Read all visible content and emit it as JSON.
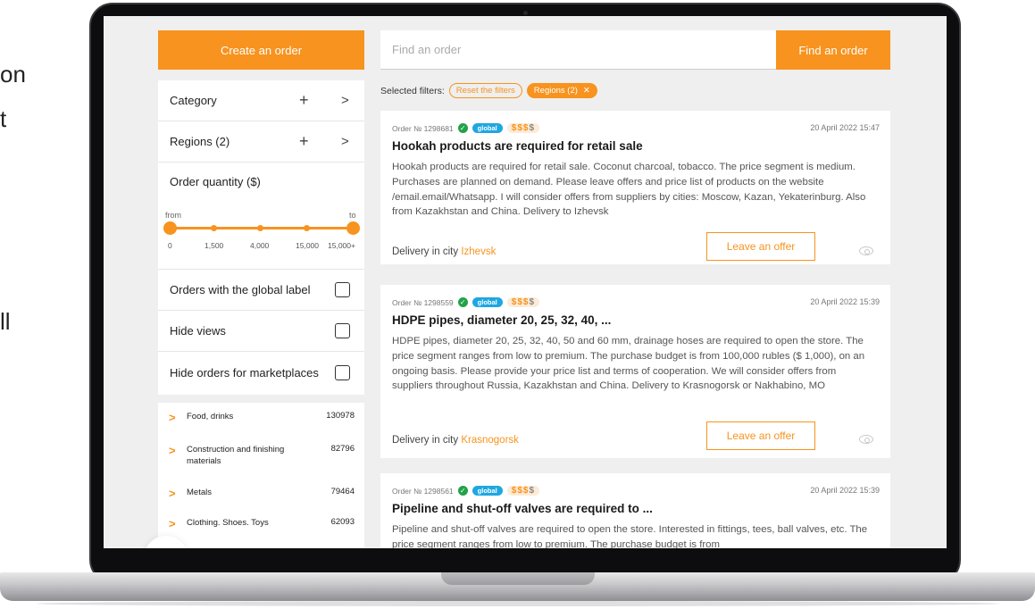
{
  "background_fragments": [
    "on",
    "t",
    "ll"
  ],
  "sidebar": {
    "create_label": "Create an order",
    "rows": [
      {
        "label": "Category"
      },
      {
        "label": "Regions (2)"
      }
    ],
    "slider": {
      "title": "Order quantity ($)",
      "from_label": "from",
      "to_label": "to",
      "ticks": [
        "0",
        "1,500",
        "4,000",
        "15,000",
        "15,000+"
      ]
    },
    "checkboxes": [
      {
        "label": "Orders with the global label",
        "checked": false
      },
      {
        "label": "Hide views",
        "checked": false
      },
      {
        "label": "Hide orders for marketplaces",
        "checked": false
      }
    ],
    "categories": [
      {
        "name": "Food, drinks",
        "count": "130978"
      },
      {
        "name": "Construction and finishing materials",
        "count": "82796"
      },
      {
        "name": "Metals",
        "count": "79464"
      },
      {
        "name": "Clothing. Shoes. Toys",
        "count": "62093"
      }
    ]
  },
  "search": {
    "placeholder": "Find an order",
    "button_label": "Find an order"
  },
  "filters": {
    "label": "Selected filters:",
    "reset_label": "Reset the filters",
    "active_chip": "Regions (2)",
    "close_glyph": "✕"
  },
  "orders": [
    {
      "number": "Order № 1298681",
      "badge": "global",
      "price_on": "$$$",
      "price_off": "$",
      "date": "20 April 2022 15:47",
      "title": "Hookah products are required for retail sale",
      "description": "Hookah products are required for retail sale. Coconut charcoal, tobacco. The price segment is medium. Purchases are planned on demand. Please leave offers and price list of products on the website /email.email/Whatsapp. I will consider offers from suppliers by cities: Moscow, Kazan, Yekaterinburg. Also from Kazakhstan and China. Delivery to Izhevsk",
      "delivery_prefix": "Delivery in city",
      "city": "Izhevsk",
      "offer_label": "Leave an offer"
    },
    {
      "number": "Order № 1298559",
      "badge": "global",
      "price_on": "$$$",
      "price_off": "$",
      "date": "20 April 2022 15:39",
      "title": "HDPE pipes, diameter 20, 25, 32, 40, ...",
      "description": "HDPE pipes, diameter 20, 25, 32, 40, 50 and 60 mm, drainage hoses are required to open the store. The price segment ranges from low to premium. The purchase budget is from 100,000 rubles ($ 1,000), on an ongoing basis. Please provide your price list and terms of cooperation. We will consider offers from suppliers throughout Russia, Kazakhstan and China. Delivery to Krasnogorsk or Nakhabino, MO",
      "delivery_prefix": "Delivery in city",
      "city": "Krasnogorsk",
      "offer_label": "Leave an offer"
    },
    {
      "number": "Order № 1298561",
      "badge": "global",
      "price_on": "$$$",
      "price_off": "$",
      "date": "20 April 2022 15:39",
      "title": "Pipeline and shut-off valves are required to ...",
      "description": "Pipeline and shut-off valves are required to open the store. Interested in fittings, tees, ball valves, etc. The price segment ranges from low to premium. The purchase budget is from"
    }
  ],
  "colors": {
    "accent": "#f7931e",
    "global_badge": "#1ea7e1",
    "verified": "#22a24a"
  }
}
